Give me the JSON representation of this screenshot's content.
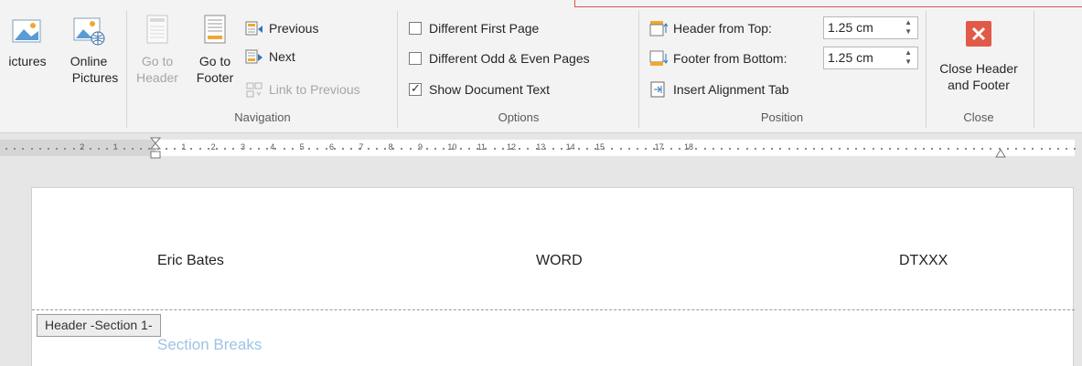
{
  "ribbon": {
    "insert_group": {
      "pictures_label": "ictures",
      "online_pictures_label_1": "Online",
      "online_pictures_label_2": "Pictures"
    },
    "navigation": {
      "group_label": "Navigation",
      "goto_header_1": "Go to",
      "goto_header_2": "Header",
      "goto_footer_1": "Go to",
      "goto_footer_2": "Footer",
      "previous": "Previous",
      "next": "Next",
      "link_to_previous": "Link to Previous"
    },
    "options": {
      "group_label": "Options",
      "different_first_page": "Different First Page",
      "different_odd_even": "Different Odd & Even Pages",
      "show_document_text": "Show Document Text",
      "show_document_text_checked": true
    },
    "position": {
      "group_label": "Position",
      "header_from_top_label": "Header from Top:",
      "header_from_top_value": "1.25 cm",
      "footer_from_bottom_label": "Footer from Bottom:",
      "footer_from_bottom_value": "1.25 cm",
      "insert_alignment_tab": "Insert Alignment Tab"
    },
    "close": {
      "group_label": "Close",
      "close_label_1": "Close Header",
      "close_label_2": "and Footer"
    }
  },
  "ruler": {
    "left_numbers": [
      "2",
      "1"
    ],
    "right_numbers": [
      "1",
      "2",
      "3",
      "4",
      "5",
      "6",
      "7",
      "8",
      "9",
      "10",
      "11",
      "12",
      "13",
      "14",
      "15",
      "17",
      "18"
    ]
  },
  "document": {
    "header_left": "Eric Bates",
    "header_center": "WORD",
    "header_right": "DTXXX",
    "header_tag": "Header -Section 1-",
    "body_heading": "Section Breaks"
  },
  "colors": {
    "close_red": "#e05a47",
    "accent_orange": "#f0a830",
    "heading_blue": "#9dc3e6"
  }
}
